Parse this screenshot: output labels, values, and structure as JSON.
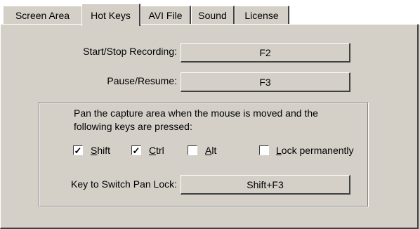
{
  "tabs": [
    {
      "label": "Screen Area"
    },
    {
      "label": "Hot Keys",
      "active": true
    },
    {
      "label": "AVI File"
    },
    {
      "label": "Sound"
    },
    {
      "label": "License"
    }
  ],
  "hotkeys": {
    "start_stop_label": "Start/Stop Recording:",
    "start_stop_key": "F2",
    "pause_resume_label": "Pause/Resume:",
    "pause_resume_key": "F3"
  },
  "pan": {
    "description_line1": "Pan the capture area when the mouse is moved and the",
    "description_line2": "following keys are pressed:",
    "shift": {
      "label_first": "S",
      "label_rest": "hift",
      "checked": true
    },
    "ctrl": {
      "label_first": "C",
      "label_rest": "trl",
      "checked": true
    },
    "alt": {
      "label_first": "A",
      "label_rest": "lt",
      "checked": false
    },
    "lock": {
      "label_first": "L",
      "label_rest": "ock permanently",
      "checked": false
    },
    "switch_label": "Key to Switch Pan Lock:",
    "switch_key": "Shift+F3"
  }
}
